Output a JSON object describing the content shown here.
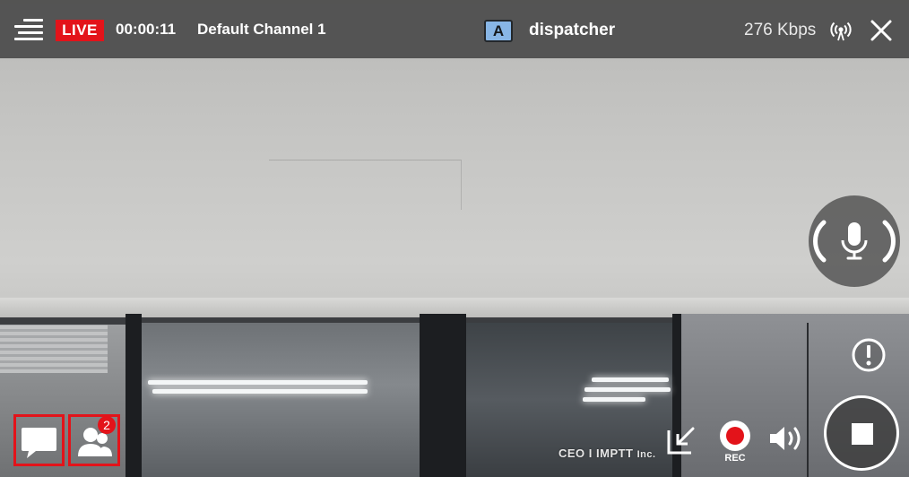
{
  "header": {
    "live_label": "LIVE",
    "elapsed_time": "00:00:11",
    "channel_name": "Default Channel 1",
    "user_badge": "A",
    "user_name": "dispatcher",
    "bitrate": "276 Kbps"
  },
  "icons": {
    "menu": "menu-lines-icon",
    "signal": "broadcast-signal-icon",
    "close": "close-icon",
    "mic": "microphone-icon",
    "alert": "exclamation-circle-icon",
    "stop": "stop-square-icon",
    "chat": "chat-bubble-icon",
    "members": "people-icon",
    "pip": "minimize-arrow-icon",
    "record": "record-dot-icon",
    "speaker": "speaker-icon"
  },
  "controls": {
    "members_count": "2",
    "rec_label": "REC"
  },
  "video": {
    "watermark_main": "CEO I IMPTT",
    "watermark_suffix": "Inc."
  },
  "colors": {
    "live_red": "#e3131a",
    "badge_blue": "#88b6e6",
    "bar_bg": "#464646"
  }
}
